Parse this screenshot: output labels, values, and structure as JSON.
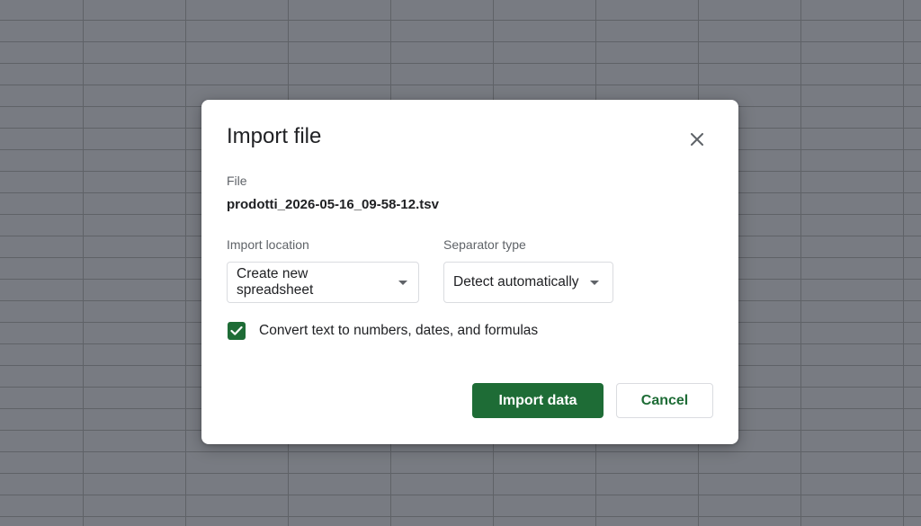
{
  "dialog": {
    "title": "Import file",
    "file_label": "File",
    "file_name": "prodotti_2026-05-16_09-58-12.tsv",
    "import_location": {
      "label": "Import location",
      "selected": "Create new spreadsheet"
    },
    "separator_type": {
      "label": "Separator type",
      "selected": "Detect automatically"
    },
    "convert_option": {
      "label": "Convert text to numbers, dates, and formulas",
      "checked": true
    },
    "buttons": {
      "import": "Import data",
      "cancel": "Cancel"
    }
  },
  "icons": {
    "close": "close-icon",
    "dropdown": "caret-down-icon",
    "check": "checkmark-icon"
  },
  "colors": {
    "primary": "#1e6c36",
    "overlay": "#787b82",
    "text": "#202124",
    "muted": "#5f6368"
  }
}
